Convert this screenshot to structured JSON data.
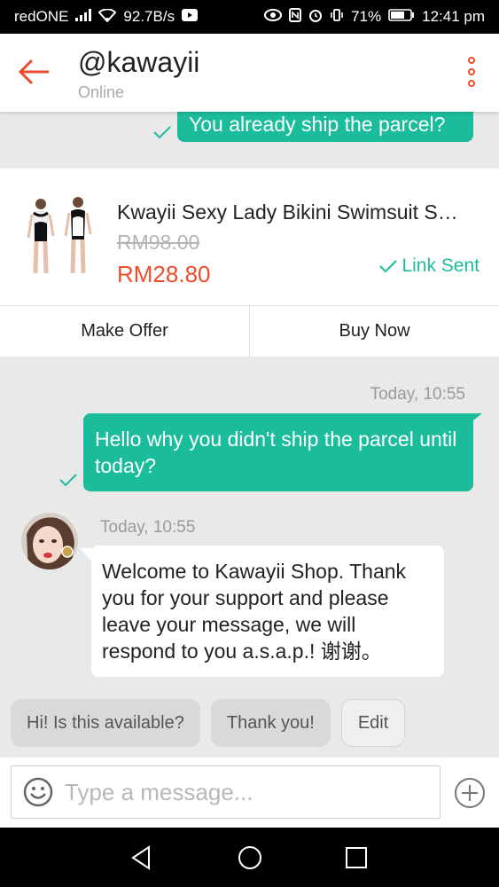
{
  "status_bar": {
    "carrier": "redONE",
    "speed": "92.7B/s",
    "battery": "71%",
    "time": "12:41 pm"
  },
  "header": {
    "title": "@kawayii",
    "subtitle": "Online"
  },
  "messages": {
    "prev_out": "You already ship the parcel?",
    "product": {
      "name": "Kwayii Sexy Lady Bikini Swimsuit S…",
      "old_price": "RM98.00",
      "new_price": "RM28.80",
      "link_status": "Link Sent",
      "make_offer": "Make Offer",
      "buy_now": "Buy Now"
    },
    "out_timestamp": "Today, 10:55",
    "out_text": "Hello why you didn't ship the parcel until today?",
    "in_timestamp": "Today, 10:55",
    "in_text": "Welcome to Kawayii Shop. Thank you for your support and please leave your message, we will respond to you a.s.a.p.! 谢谢。"
  },
  "quick_replies": [
    "Hi! Is this available?",
    "Thank you!",
    "Edit"
  ],
  "input": {
    "placeholder": "Type a message..."
  },
  "colors": {
    "accent": "#ee4d2d",
    "bubble": "#1bbc9b"
  }
}
